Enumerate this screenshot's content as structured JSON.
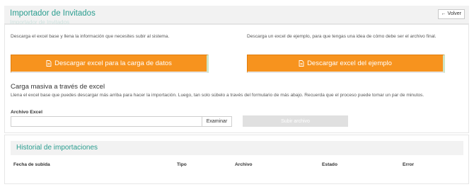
{
  "header": {
    "title": "Importador de Invitados",
    "subtitle": "Importador de Invitados",
    "back_label": "Volver"
  },
  "main": {
    "left_description": "Descarga el excel base y llena la información que necesites subir al sistema.",
    "right_description": "Descarga un excel de ejemplo, para que tengas una idea de cómo debe ser el archivo final.",
    "download_base_label": "Descargar excel para la carga de datos",
    "download_example_label": "Descargar excel del ejemplo",
    "bulk_title": "Carga masiva a través de excel",
    "bulk_description": "Llena el excel base que puedes descargar más arriba para hacer la importación. Luego, tan solo súbelo a través del formulario de más abajo. Recuerda que el proceso puede tomar un par de minutos.",
    "file_label": "Archivo Excel",
    "file_value": "",
    "browse_label": "Examinar",
    "upload_label": "Subir archivo"
  },
  "history": {
    "title": "Historial de importaciones",
    "columns": [
      "Fecha de subida",
      "Tipo",
      "Archivo",
      "Estado",
      "Error"
    ]
  },
  "colors": {
    "accent": "#2a9d8f",
    "button_orange": "#f7931e"
  },
  "icons": {
    "back": "arrow-left-icon",
    "file": "file-icon"
  }
}
